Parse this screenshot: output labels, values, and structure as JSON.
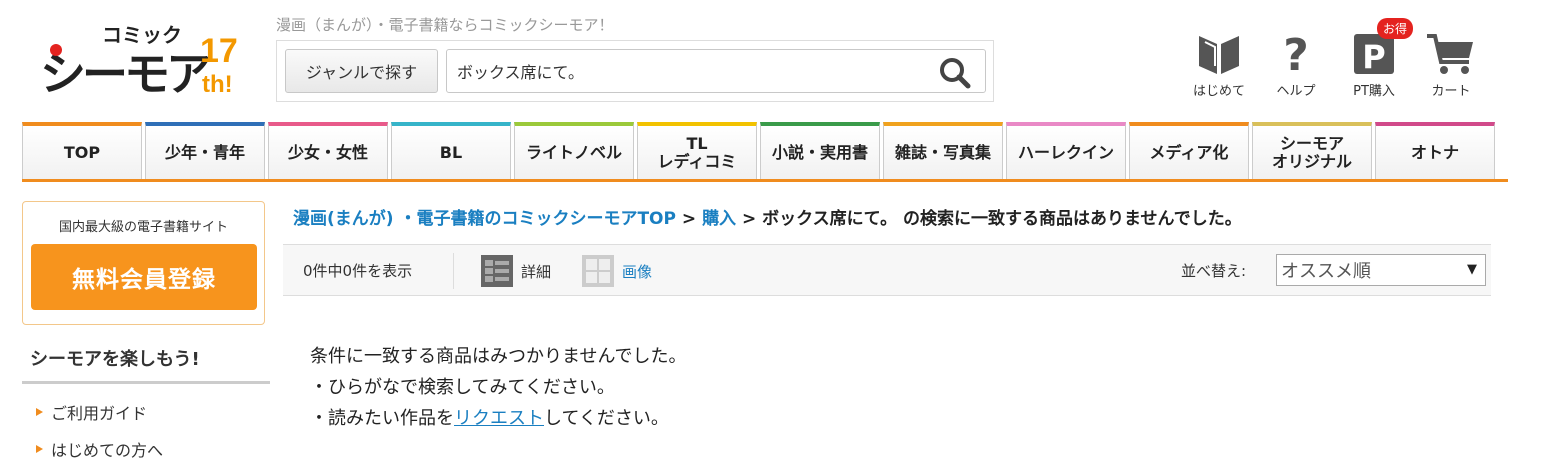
{
  "header": {
    "logo_top": "コミック",
    "logo_main": "シーモア",
    "logo_anniv_num": "17",
    "logo_anniv_suffix": "th!",
    "tagline": "漫画（まんが）・電子書籍ならコミックシーモア！",
    "genre_button": "ジャンルで探す",
    "search_value": "ボックス席にて。",
    "icons": [
      {
        "name": "beginner-icon",
        "label": "はじめて"
      },
      {
        "name": "help-icon",
        "label": "ヘルプ"
      },
      {
        "name": "points-icon",
        "label": "PT購入",
        "badge": "お得"
      },
      {
        "name": "cart-icon",
        "label": "カート"
      }
    ]
  },
  "nav": {
    "tabs": [
      {
        "label": "TOP",
        "color": "#f08c1e"
      },
      {
        "label": "少年・青年",
        "color": "#2f6fb7"
      },
      {
        "label": "少女・女性",
        "color": "#e85a8a"
      },
      {
        "label": "BL",
        "color": "#36b4c9"
      },
      {
        "label": "ライトノベル",
        "color": "#9bc93a"
      },
      {
        "label": "TL\nレディコミ",
        "color": "#f2c200"
      },
      {
        "label": "小説・実用書",
        "color": "#3a9b4a"
      },
      {
        "label": "雑誌・写真集",
        "color": "#f0a21e"
      },
      {
        "label": "ハーレクイン",
        "color": "#e989c6"
      },
      {
        "label": "メディア化",
        "color": "#f08c1e"
      },
      {
        "label": "シーモア\nオリジナル",
        "color": "#d9c05a"
      },
      {
        "label": "オトナ",
        "color": "#d14a8a"
      }
    ]
  },
  "sidebar": {
    "reg_caption": "国内最大級の電子書籍サイト",
    "reg_button": "無料会員登録",
    "heading": "シーモアを楽しもう!",
    "links": [
      "ご利用ガイド",
      "はじめての方へ"
    ]
  },
  "main": {
    "breadcrumb": {
      "home": "漫画(まんが) ・電子書籍のコミックシーモアTOP",
      "sep": " > ",
      "buy": "購入",
      "tail": "ボックス席にて。 の検索に一致する商品はありませんでした。"
    },
    "count": "0件中0件を表示",
    "view_detail": "詳細",
    "view_image": "画像",
    "sort_label": "並べ替え:",
    "sort_value": "オススメ順",
    "messages": {
      "line1": "条件に一致する商品はみつかりませんでした。",
      "line2": "・ひらがなで検索してみてください。",
      "line3_pre": "・読みたい作品を",
      "line3_link": "リクエスト",
      "line3_post": "してください。"
    }
  },
  "colors": {
    "accent": "#f08c1e",
    "link": "#1a7fc1",
    "register": "#f7941d",
    "logo_red": "#e4231f",
    "logo_orange": "#f39800"
  }
}
